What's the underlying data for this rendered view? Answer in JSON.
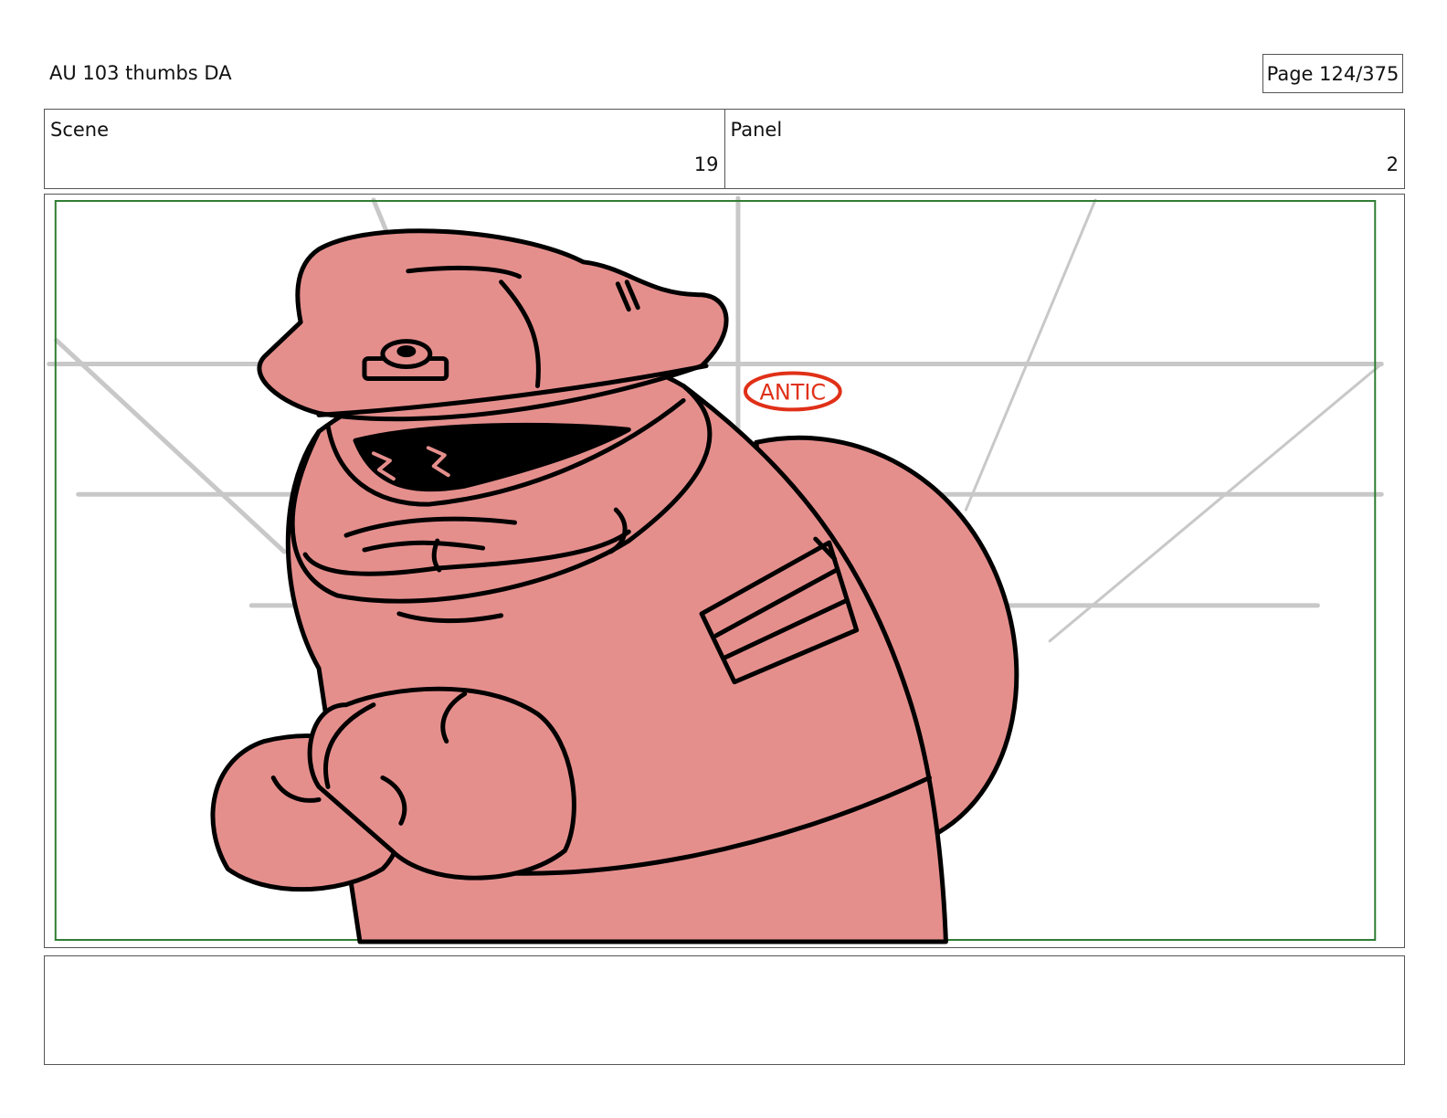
{
  "header": {
    "doc_title": "AU 103 thumbs DA",
    "page_label": "Page 124/375"
  },
  "info": {
    "scene_label": "Scene",
    "scene_value": "19",
    "panel_label": "Panel",
    "panel_value": "2"
  },
  "panel": {
    "annotation": "ANTIC",
    "colors": {
      "character_fill": "#e58f8d",
      "ink": "#000000",
      "guide_lines": "#c8c8c8",
      "safe_frame": "#2e7d32",
      "annotation": "#e03018"
    }
  },
  "notes": {
    "text": ""
  }
}
